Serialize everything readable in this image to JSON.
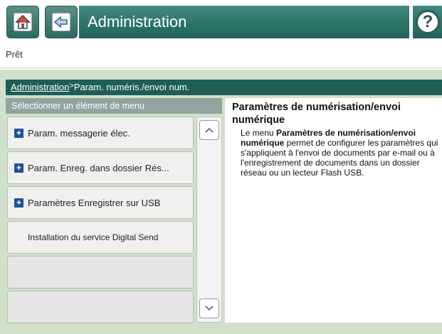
{
  "header": {
    "title": "Administration",
    "home_icon": "home-icon",
    "back_icon": "back-arrow-icon",
    "help_icon": "help-icon",
    "help_glyph": "?"
  },
  "status": {
    "text": "Prêt"
  },
  "breadcrumb": {
    "link": "Administration",
    "separator": ">",
    "current": "Param. numéris./envoi num."
  },
  "menu": {
    "header": "Sélectionner un élément de menu",
    "items": [
      {
        "label": "Param. messagerie élec.",
        "expandable": true
      },
      {
        "label": "Param. Enreg. dans dossier Rés...",
        "expandable": true
      },
      {
        "label": "Paramètres Enregistrer sur USB",
        "expandable": true
      },
      {
        "label": "Installation du service Digital Send",
        "expandable": false
      },
      {
        "label": "",
        "expandable": false
      },
      {
        "label": "",
        "expandable": false
      }
    ]
  },
  "description": {
    "title": "Paramètres de numérisation/envoi numérique",
    "body_prefix": "Le menu ",
    "body_bold": "Paramètres de numérisation/envoi numérique",
    "body_suffix": " permet de configurer les paramètres qui s'appliquent à l'envoi de documents par e-mail ou à l'enregistrement de documents dans un dossier réseau ou un lecteur Flash USB."
  },
  "colors": {
    "accent": "#1d5e55",
    "panel_bg": "#cfe2c9",
    "menu_header_bg": "#93a3a0",
    "expand_icon": "#1f4f9a"
  }
}
